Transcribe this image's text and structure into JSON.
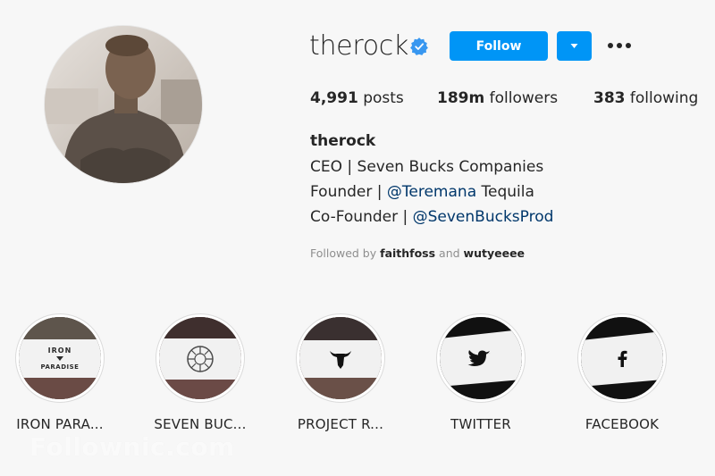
{
  "profile": {
    "username": "therock",
    "verified_icon": "verified-badge-icon",
    "follow_label": "Follow",
    "dropdown_icon": "caret-down-icon",
    "more_icon": "more-dots-icon"
  },
  "stats": {
    "posts_count": "4,991",
    "posts_label": "posts",
    "followers_count": "189m",
    "followers_label": "followers",
    "following_count": "383",
    "following_label": "following"
  },
  "bio": {
    "name": "therock",
    "line1": "CEO | Seven Bucks Companies",
    "line2_prefix": "Founder | ",
    "line2_mention": "@Teremana",
    "line2_suffix": " Tequila",
    "line3_prefix": "Co-Founder | ",
    "line3_mention": "@SevenBucksProd"
  },
  "followed_by": {
    "prefix": "Followed by ",
    "user1": "faithfoss",
    "joiner": " and ",
    "user2": "wutyeeee"
  },
  "highlights": [
    {
      "label": "IRON PARA...",
      "icon": "iron-paradise-logo",
      "logo_text_1": "IRON",
      "logo_text_2": "PARADISE"
    },
    {
      "label": "SEVEN BUC...",
      "icon": "seven-bucks-logo"
    },
    {
      "label": "PROJECT R...",
      "icon": "bull-head-icon"
    },
    {
      "label": "TWITTER",
      "icon": "twitter-icon"
    },
    {
      "label": "FACEBOOK",
      "icon": "facebook-icon"
    }
  ],
  "watermark": "Follownic.com",
  "colors": {
    "accent": "#0095f6",
    "mention": "#00376b",
    "muted": "#8e8e8e",
    "text": "#262626",
    "background": "#f7f7f7"
  }
}
